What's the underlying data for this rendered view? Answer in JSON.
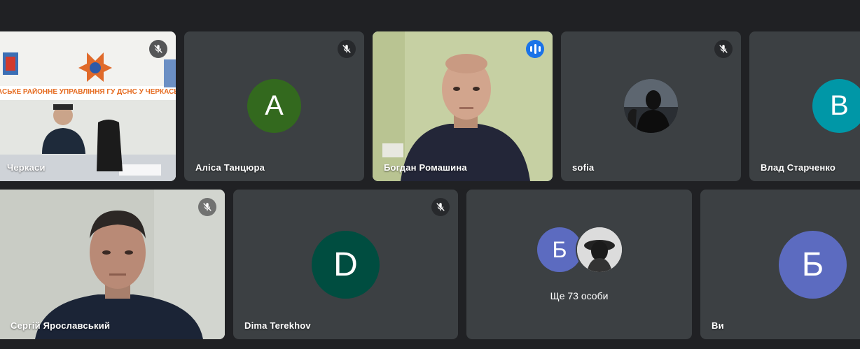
{
  "row1": [
    {
      "name": "Черкаси",
      "muted": true,
      "banner_text": "АСЬКЕ РАЙОННЕ УПРАВЛІННЯ ГУ ДСНС У ЧЕРКАСЬКІЙ О"
    },
    {
      "name": "Аліса Танцюра",
      "muted": true,
      "avatar_letter": "А",
      "avatar_color": "#33691e"
    },
    {
      "name": "Богдан Ромашина",
      "speaking": true
    },
    {
      "name": "sofia",
      "muted": true
    },
    {
      "name": "Влад Старченко",
      "avatar_letter": "В",
      "avatar_color": "#0097a7"
    }
  ],
  "row2": [
    {
      "name": "Сергій Ярославський",
      "muted": true
    },
    {
      "name": "Dima Terekhov",
      "muted": true,
      "avatar_letter": "D",
      "avatar_color": "#004d40"
    },
    {
      "more_label": "Ще 73 особи",
      "avatar_letter": "Б",
      "avatar_color": "#5c6bc0"
    },
    {
      "name": "Ви",
      "avatar_letter": "Б",
      "avatar_color": "#5c6bc0"
    }
  ],
  "colors": {
    "background": "#202124",
    "tile": "#3c4043",
    "active_border": "#8ab4f8",
    "speaking_badge": "#1a73e8"
  },
  "icons": {
    "muted": "mic-off-icon",
    "speaking": "audio-level-icon"
  }
}
